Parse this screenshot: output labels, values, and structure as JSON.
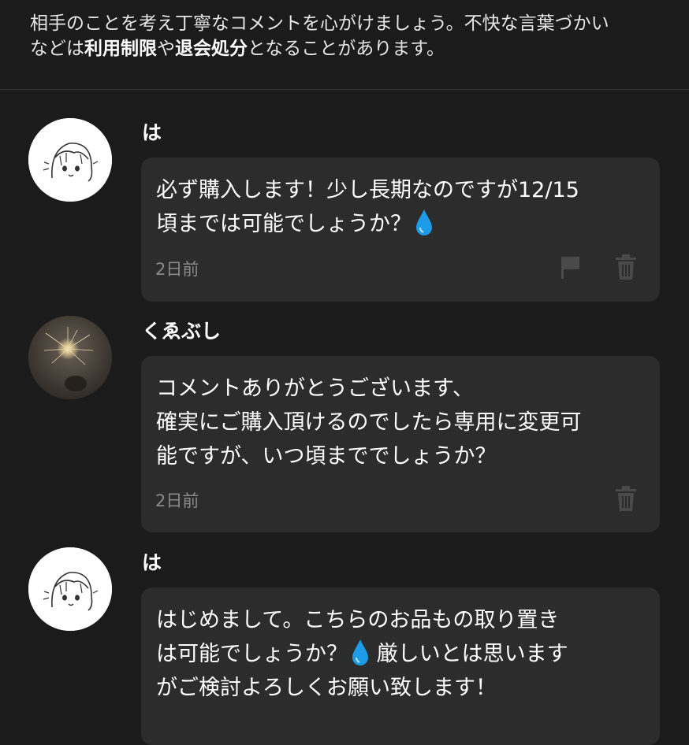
{
  "notice": {
    "text_1": "相手のことを考え丁寧なコメントを心がけましょう。不快な言葉づかい",
    "text_2": "などは",
    "bold_1": "利用制限",
    "text_3": "や",
    "bold_2": "退会処分",
    "text_4": "となることがあります。"
  },
  "comments": [
    {
      "user": "は",
      "message": "必ず購入します！少し長期なのですが12/15\n頃までは可能でしょうか？",
      "emoji": "droplet-emoji",
      "time": "2日前",
      "actions": [
        "flag-icon",
        "trash-icon"
      ]
    },
    {
      "user": "くゑぶし",
      "message": "コメントありがとうございます、\n確実にご購入頂けるのでしたら専用に変更可\n能ですが、いつ頃まででしょうか？",
      "time": "2日前",
      "actions": [
        "trash-icon"
      ]
    },
    {
      "user": "は",
      "message_1": "はじめまして。こちらのお品もの取り置き\nは可能でしょうか？",
      "emoji": "droplet-emoji",
      "message_2": "厳しいとは思います\nがご検討よろしくお願い致します！"
    }
  ],
  "colors": {
    "background": "#1b1b1b",
    "bubble": "#2c2c2c",
    "muted": "#8a8a8a",
    "icon": "#4a4a4a",
    "drop": "#1e9be8"
  }
}
